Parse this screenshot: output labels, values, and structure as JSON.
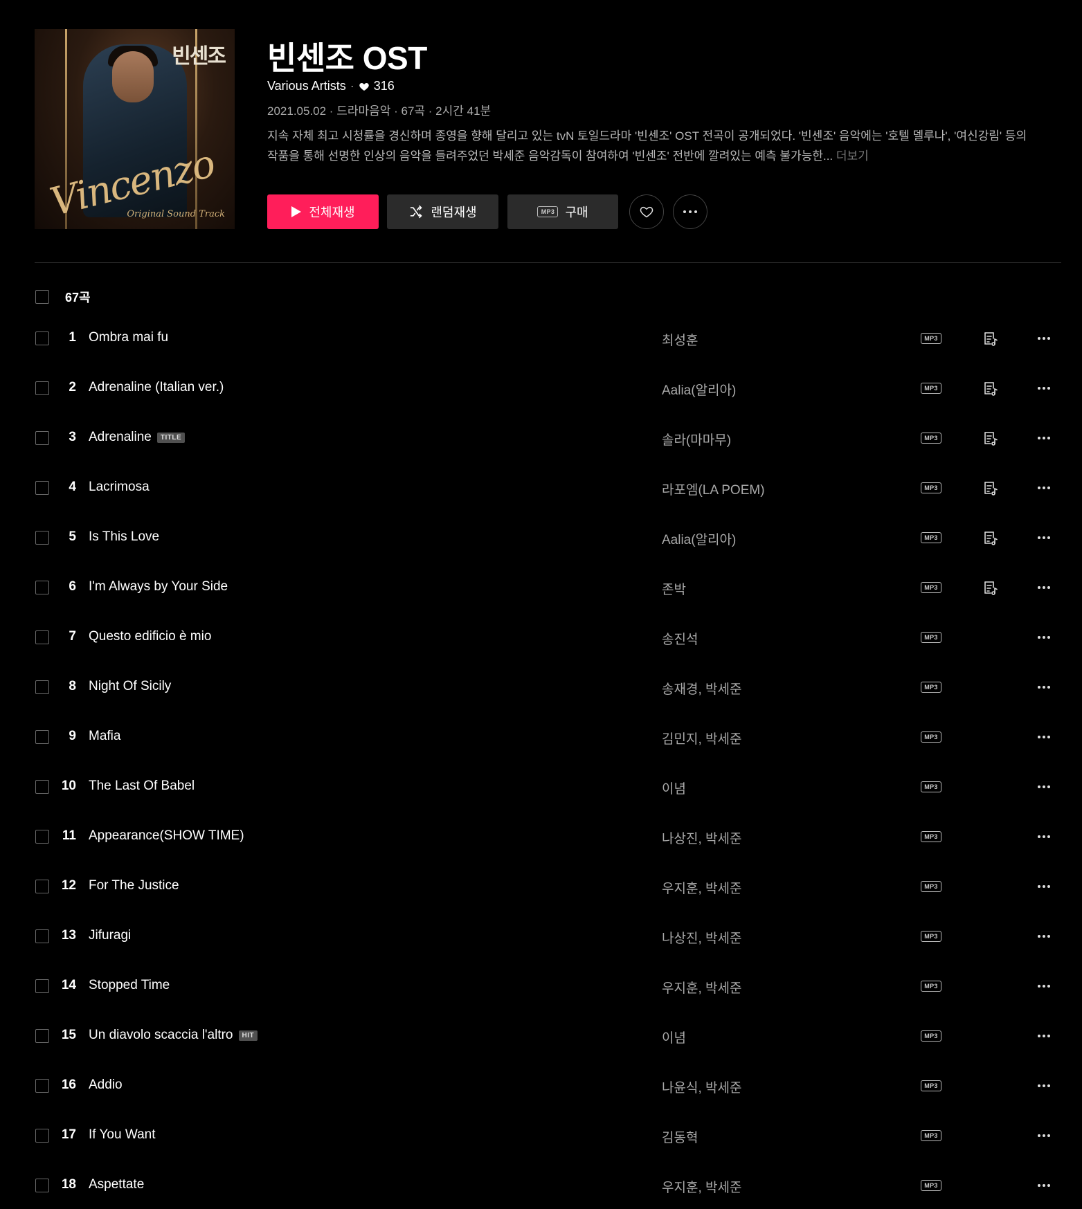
{
  "album": {
    "cover_logo": "빈센조",
    "cover_script": "Vincenzo",
    "cover_subtitle": "Original Sound Track",
    "title": "빈센조 OST",
    "artist": "Various Artists",
    "likes": "316",
    "info": "2021.05.02 · 드라마음악 · 67곡 · 2시간 41분",
    "description": "지속 자체 최고 시청률을 경신하며 종영을 향해 달리고 있는 tvN 토일드라마 '빈센조' OST 전곡이 공개되었다. '빈센조' 음악에는 '호텔 델루나', '여신강림' 등의 작품을 통해 선명한 인상의 음악을 들려주었던 박세준 음악감독이 참여하여 '빈센조' 전반에 깔려있는 예측 불가능한...",
    "more_label": "더보기"
  },
  "actions": {
    "play_all": "전체재생",
    "shuffle": "랜덤재생",
    "buy": "구매",
    "mp3": "MP3"
  },
  "list": {
    "count_label": "67곡",
    "tracks": [
      {
        "num": "1",
        "title": "Ombra mai fu",
        "artist": "최성훈",
        "tag": "",
        "lyrics": true
      },
      {
        "num": "2",
        "title": "Adrenaline (Italian ver.)",
        "artist": "Aalia(알리아)",
        "tag": "",
        "lyrics": true
      },
      {
        "num": "3",
        "title": "Adrenaline",
        "artist": "솔라(마마무)",
        "tag": "TITLE",
        "lyrics": true
      },
      {
        "num": "4",
        "title": "Lacrimosa",
        "artist": "라포엠(LA POEM)",
        "tag": "",
        "lyrics": true
      },
      {
        "num": "5",
        "title": "Is This Love",
        "artist": "Aalia(알리아)",
        "tag": "",
        "lyrics": true
      },
      {
        "num": "6",
        "title": "I'm Always by Your Side",
        "artist": "존박",
        "tag": "",
        "lyrics": true
      },
      {
        "num": "7",
        "title": "Questo edificio è mio",
        "artist": "송진석",
        "tag": "",
        "lyrics": false
      },
      {
        "num": "8",
        "title": "Night Of Sicily",
        "artist": "송재경, 박세준",
        "tag": "",
        "lyrics": false
      },
      {
        "num": "9",
        "title": "Mafia",
        "artist": "김민지, 박세준",
        "tag": "",
        "lyrics": false
      },
      {
        "num": "10",
        "title": "The Last Of Babel",
        "artist": "이념",
        "tag": "",
        "lyrics": false
      },
      {
        "num": "11",
        "title": "Appearance(SHOW TIME)",
        "artist": "나상진, 박세준",
        "tag": "",
        "lyrics": false
      },
      {
        "num": "12",
        "title": "For The Justice",
        "artist": "우지훈, 박세준",
        "tag": "",
        "lyrics": false
      },
      {
        "num": "13",
        "title": "Jifuragi",
        "artist": "나상진, 박세준",
        "tag": "",
        "lyrics": false
      },
      {
        "num": "14",
        "title": "Stopped Time",
        "artist": "우지훈, 박세준",
        "tag": "",
        "lyrics": false
      },
      {
        "num": "15",
        "title": "Un diavolo scaccia l'altro",
        "artist": "이념",
        "tag": "HIT",
        "lyrics": false
      },
      {
        "num": "16",
        "title": "Addio",
        "artist": "나윤식, 박세준",
        "tag": "",
        "lyrics": false
      },
      {
        "num": "17",
        "title": "If You Want",
        "artist": "김동혁",
        "tag": "",
        "lyrics": false
      },
      {
        "num": "18",
        "title": "Aspettate",
        "artist": "우지훈, 박세준",
        "tag": "",
        "lyrics": false
      }
    ]
  },
  "colors": {
    "accent": "#ff1e5a",
    "button_dark": "#2b2b2b",
    "background": "#000000"
  },
  "icons": [
    "play-icon",
    "shuffle-icon",
    "mp3-icon",
    "heart-icon",
    "more-icon",
    "lyrics-icon"
  ]
}
